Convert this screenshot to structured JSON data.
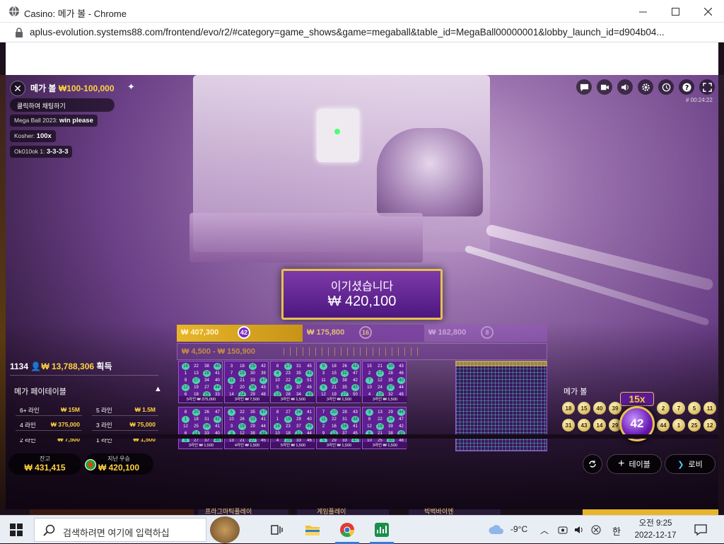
{
  "window": {
    "title": "Casino: 메가 볼 - Chrome",
    "url": "aplus-evolution.systems88.com/frontend/evo/r2/#category=game_shows&game=megaball&table_id=MegaBall00000001&lobby_launch_id=d904b04..."
  },
  "game": {
    "name": "메가 볼",
    "limits": "₩100-100,000",
    "timer": "# 00:24:22"
  },
  "chat": {
    "toggle_label": "클릭하여 채팅하기",
    "messages": [
      {
        "user": "Mega Ball 2023:",
        "text": "win please"
      },
      {
        "user": "Kosher:",
        "text": "100x"
      },
      {
        "user": "Ok010ok 1:",
        "text": "3-3-3-3"
      }
    ]
  },
  "win": {
    "title": "이기셨습니다",
    "amount": "₩ 420,100"
  },
  "tiers": [
    {
      "amount": "₩ 407,300",
      "ball": "42"
    },
    {
      "amount": "₩ 175,800",
      "ball": "16"
    },
    {
      "amount": "₩ 162,800",
      "ball": "8"
    }
  ],
  "tier_range": "₩ 4,500 - ₩ 150,900",
  "stats": {
    "players": "1134",
    "total_won": "₩ 13,788,306",
    "won_label": "획득"
  },
  "paytable": {
    "title": "메가 페이테이블",
    "rows": [
      {
        "label": "6+ 라인",
        "value": "₩ 15M"
      },
      {
        "label": "5 라인",
        "value": "₩ 1.5M"
      },
      {
        "label": "4 라인",
        "value": "₩ 375,000"
      },
      {
        "label": "3 라인",
        "value": "₩ 75,000"
      },
      {
        "label": "2 라인",
        "value": "₩ 7,500"
      },
      {
        "label": "1 라인",
        "value": "₩ 1,500"
      }
    ]
  },
  "balance": {
    "label": "잔고",
    "value": "₩ 431,415"
  },
  "last_win": {
    "label": "지난 우승",
    "value": "₩ 420,100"
  },
  "cards": [
    {
      "prize": "5라인 ₩ 375,000",
      "nums": [
        "16",
        "22",
        "38",
        "45",
        "1",
        "13",
        "28",
        "41",
        "9",
        "17",
        "34",
        "40",
        "12",
        "19",
        "27",
        "44",
        "6",
        "18",
        "25",
        "33"
      ]
    },
    {
      "prize": "3라인 ₩ 7,500",
      "nums": [
        "3",
        "18",
        "25",
        "42",
        "7",
        "15",
        "30",
        "39",
        "11",
        "21",
        "33",
        "47",
        "2",
        "20",
        "36",
        "43",
        "14",
        "24",
        "29",
        "48"
      ]
    },
    {
      "prize": "3라인 ₩ 1,500",
      "nums": [
        "8",
        "17",
        "31",
        "45",
        "4",
        "23",
        "35",
        "43",
        "10",
        "22",
        "38",
        "51",
        "5",
        "16",
        "37",
        "46",
        "13",
        "28",
        "34",
        "49"
      ]
    },
    {
      "prize": "3라인 ₩ 1,500",
      "nums": [
        "9",
        "18",
        "26",
        "43",
        "3",
        "15",
        "32",
        "47",
        "11",
        "23",
        "38",
        "42",
        "6",
        "21",
        "35",
        "45",
        "12",
        "19",
        "27",
        "50"
      ]
    },
    {
      "prize": "3라인 ₩ 1,500",
      "nums": [
        "15",
        "21",
        "30",
        "43",
        "2",
        "17",
        "28",
        "46",
        "7",
        "12",
        "35",
        "40",
        "10",
        "24",
        "37",
        "44",
        "4",
        "19",
        "32",
        "48"
      ]
    },
    {
      "prize": "3라인 ₩ 1,500",
      "nums": [
        "8",
        "20",
        "26",
        "47",
        "1",
        "18",
        "31",
        "42",
        "12",
        "25",
        "38",
        "41",
        "6",
        "14",
        "33",
        "40",
        "9",
        "27",
        "37",
        "46"
      ]
    },
    {
      "prize": "4라인 ₩ 1,500",
      "nums": [
        "5",
        "22",
        "35",
        "47",
        "10",
        "26",
        "33",
        "41",
        "3",
        "19",
        "29",
        "44",
        "8",
        "12",
        "38",
        "46",
        "13",
        "21",
        "27",
        "45"
      ]
    },
    {
      "prize": "5라인 ₩ 1,500",
      "nums": [
        "8",
        "27",
        "34",
        "41",
        "1",
        "16",
        "29",
        "40",
        "14",
        "23",
        "37",
        "45",
        "10",
        "18",
        "31",
        "44",
        "4",
        "19",
        "33",
        "46"
      ]
    },
    {
      "prize": "3라인 ₩ 1,500",
      "nums": [
        "7",
        "20",
        "28",
        "43",
        "11",
        "22",
        "31",
        "48",
        "2",
        "16",
        "36",
        "41",
        "9",
        "13",
        "37",
        "45",
        "5",
        "29",
        "33",
        "47"
      ]
    },
    {
      "prize": "3라인 ₩ 1,500",
      "nums": [
        "3",
        "13",
        "29",
        "44",
        "8",
        "22",
        "34",
        "47",
        "12",
        "18",
        "39",
        "42",
        "6",
        "21",
        "38",
        "45",
        "10",
        "25",
        "30",
        "48"
      ]
    }
  ],
  "megaball": {
    "title": "메가 볼",
    "multiplier": "15x",
    "number": "42",
    "drawn_row1": [
      "18",
      "15",
      "40",
      "39",
      "2",
      "7",
      "5",
      "11"
    ],
    "drawn_row2": [
      "31",
      "43",
      "14",
      "29",
      "44",
      "1",
      "25",
      "12"
    ]
  },
  "buttons": {
    "table": "테이블",
    "lobby": "로비"
  },
  "promo": [
    "프라그마틱플레이",
    "게임플레이",
    "빅벅바이엔"
  ],
  "taskbar": {
    "search_placeholder": "검색하려면 여기에 입력하십",
    "weather": "-9°C",
    "ime": "한",
    "time": "오전 9:25",
    "date": "2022-12-17"
  },
  "colors": {
    "accent_gold": "#ffd23f",
    "purple": "#6a18b3",
    "hit_green": "#4fd3b0"
  }
}
